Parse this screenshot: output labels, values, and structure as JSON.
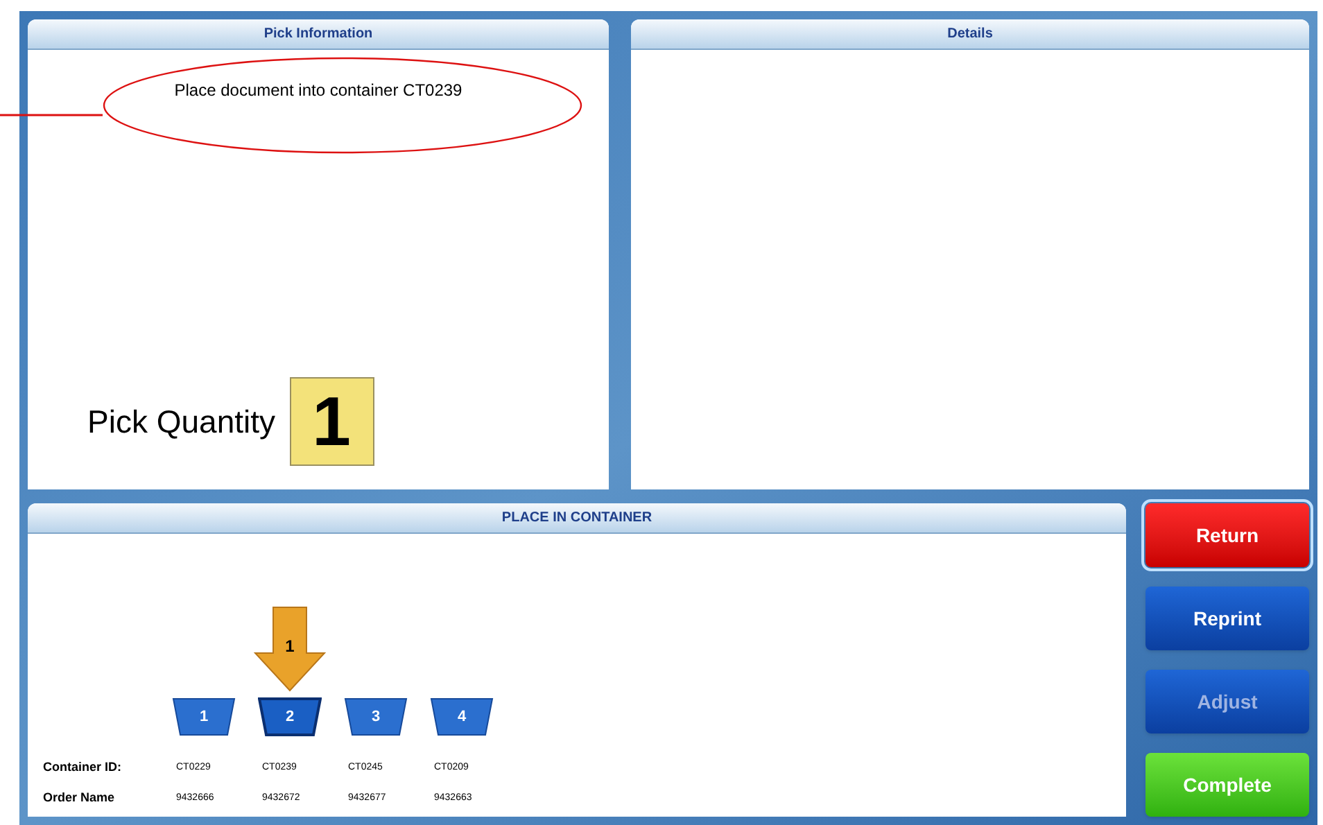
{
  "pick_information": {
    "title": "Pick Information",
    "instruction": "Place document into container CT0239",
    "quantity_label": "Pick Quantity",
    "quantity": "1"
  },
  "details": {
    "title": "Details"
  },
  "place_in_container": {
    "title": "PLACE IN CONTAINER",
    "arrow_label": "1",
    "row_labels": [
      "Container ID:",
      "Order Name"
    ],
    "containers": [
      {
        "number": "1",
        "container_id": "CT0229",
        "order_name": "9432666",
        "selected": false
      },
      {
        "number": "2",
        "container_id": "CT0239",
        "order_name": "9432672",
        "selected": true
      },
      {
        "number": "3",
        "container_id": "CT0245",
        "order_name": "9432677",
        "selected": false
      },
      {
        "number": "4",
        "container_id": "CT0209",
        "order_name": "9432663",
        "selected": false
      }
    ]
  },
  "buttons": [
    {
      "label": "Return",
      "kind": "danger",
      "disabled": false,
      "selected": true
    },
    {
      "label": "Reprint",
      "kind": "primary",
      "disabled": false,
      "selected": false
    },
    {
      "label": "Adjust",
      "kind": "primary",
      "disabled": true,
      "selected": false
    },
    {
      "label": "Complete",
      "kind": "success",
      "disabled": false,
      "selected": false
    }
  ]
}
